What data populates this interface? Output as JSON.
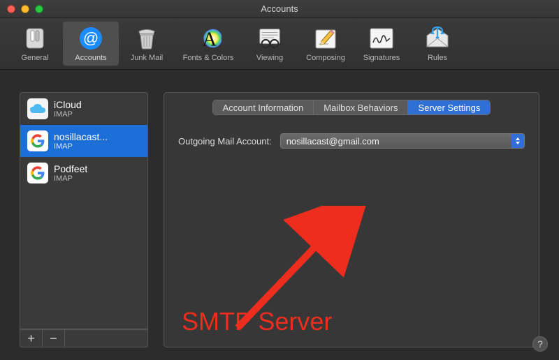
{
  "window": {
    "title": "Accounts"
  },
  "toolbar": {
    "items": [
      {
        "label": "General"
      },
      {
        "label": "Accounts"
      },
      {
        "label": "Junk Mail"
      },
      {
        "label": "Fonts & Colors"
      },
      {
        "label": "Viewing"
      },
      {
        "label": "Composing"
      },
      {
        "label": "Signatures"
      },
      {
        "label": "Rules"
      }
    ],
    "selected_index": 1
  },
  "sidebar": {
    "accounts": [
      {
        "name": "iCloud",
        "subtitle": "IMAP",
        "icon": "icloud"
      },
      {
        "name": "nosillacast...",
        "subtitle": "IMAP",
        "icon": "google"
      },
      {
        "name": "Podfeet",
        "subtitle": "IMAP",
        "icon": "google"
      }
    ],
    "selected_index": 1,
    "buttons": {
      "add": "+",
      "remove": "−"
    }
  },
  "panel": {
    "tabs": {
      "items": [
        "Account Information",
        "Mailbox Behaviors",
        "Server Settings"
      ],
      "selected_index": 2
    },
    "form": {
      "outgoing_label": "Outgoing Mail Account:",
      "outgoing_value": "nosillacast@gmail.com"
    }
  },
  "annotation": {
    "text": "SMTP Server",
    "color": "#ed2d1e"
  },
  "help": {
    "glyph": "?"
  }
}
